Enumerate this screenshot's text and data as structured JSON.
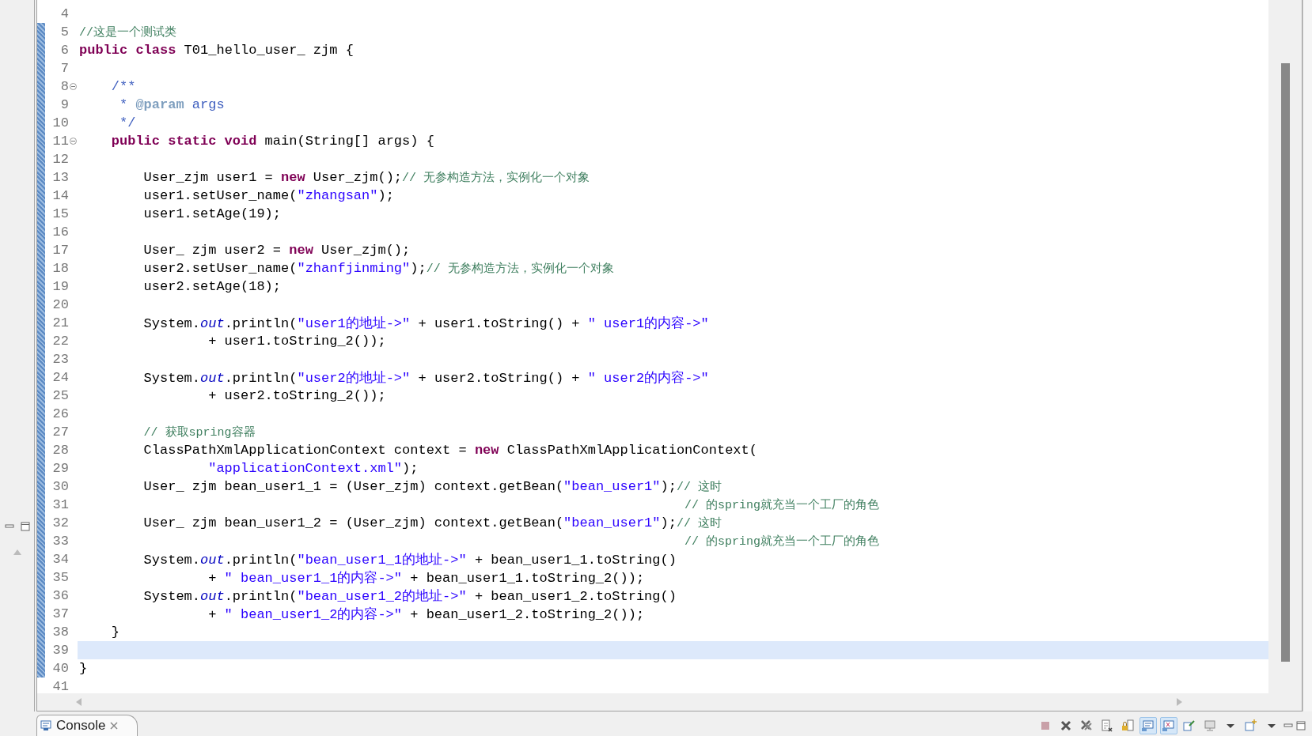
{
  "editor": {
    "lines": [
      {
        "number": "4",
        "kind": "blank",
        "folding": false,
        "current": false,
        "changed": false
      },
      {
        "number": "5",
        "kind": "top",
        "folding": false,
        "current": false,
        "changed": true,
        "segments": [
          {
            "kind": "comment",
            "text": "//这是一个测试类"
          }
        ]
      },
      {
        "number": "6",
        "kind": "top",
        "folding": false,
        "current": false,
        "changed": true,
        "segments": [
          {
            "kind": "keyword",
            "text": "public"
          },
          {
            "kind": "keyword",
            "text": "class"
          },
          {
            "kind": "plain",
            "text": " T01_hello_user_ zjm {"
          }
        ]
      },
      {
        "number": "7",
        "kind": "blank",
        "folding": false,
        "current": false,
        "changed": true
      },
      {
        "number": "8",
        "kind": "member",
        "folding": true,
        "current": false,
        "changed": true,
        "segments": [
          {
            "kind": "javadoc",
            "text": "/**"
          }
        ]
      },
      {
        "number": "9",
        "kind": "doc",
        "folding": false,
        "current": false,
        "changed": true,
        "segments": [
          {
            "kind": "javadoc",
            "text": "*"
          },
          {
            "kind": "tag",
            "text": "@param"
          },
          {
            "kind": "javadoc",
            "text": " args"
          }
        ]
      },
      {
        "number": "10",
        "kind": "doc",
        "folding": false,
        "current": false,
        "changed": true,
        "segments": [
          {
            "kind": "javadoc",
            "text": "*/"
          }
        ]
      },
      {
        "number": "11",
        "kind": "member",
        "folding": true,
        "current": false,
        "changed": true,
        "segments": [
          {
            "kind": "keyword",
            "text": "public"
          },
          {
            "kind": "keyword",
            "text": "static"
          },
          {
            "kind": "keyword",
            "text": "void"
          },
          {
            "kind": "plain",
            "text": " main(String[] args) {"
          }
        ]
      },
      {
        "number": "12",
        "kind": "blank",
        "folding": false,
        "current": false,
        "changed": true
      },
      {
        "number": "13",
        "kind": "statement",
        "folding": false,
        "current": false,
        "changed": true,
        "segments": [
          {
            "kind": "plain",
            "text": "User_zjm user1 = "
          },
          {
            "kind": "keyword",
            "text": "new"
          },
          {
            "kind": "plain",
            "text": " User_zjm();"
          },
          {
            "kind": "comment",
            "text": "// 无参构造方法，实例化一个对象"
          }
        ]
      },
      {
        "number": "14",
        "kind": "statement",
        "folding": false,
        "current": false,
        "changed": true,
        "segments": [
          {
            "kind": "plain",
            "text": "user1.setUser_name("
          },
          {
            "kind": "string",
            "text": "\"zhangsan\""
          },
          {
            "kind": "plain",
            "text": ");"
          }
        ]
      },
      {
        "number": "15",
        "kind": "statement",
        "folding": false,
        "current": false,
        "changed": true,
        "segments": [
          {
            "kind": "plain",
            "text": "user1.setAge(19);"
          }
        ]
      },
      {
        "number": "16",
        "kind": "blank",
        "folding": false,
        "current": false,
        "changed": true
      },
      {
        "number": "17",
        "kind": "statement",
        "folding": false,
        "current": false,
        "changed": true,
        "segments": [
          {
            "kind": "plain",
            "text": "User_ zjm user2 = "
          },
          {
            "kind": "keyword",
            "text": "new"
          },
          {
            "kind": "plain",
            "text": " User_zjm();"
          }
        ]
      },
      {
        "number": "18",
        "kind": "statement",
        "folding": false,
        "current": false,
        "changed": true,
        "segments": [
          {
            "kind": "plain",
            "text": "user2.setUser_name("
          },
          {
            "kind": "string",
            "text": "\"zhanfjinming\""
          },
          {
            "kind": "plain",
            "text": ");"
          },
          {
            "kind": "comment",
            "text": "// 无参构造方法，实例化一个对象"
          }
        ]
      },
      {
        "number": "19",
        "kind": "statement",
        "folding": false,
        "current": false,
        "changed": true,
        "segments": [
          {
            "kind": "plain",
            "text": "user2.setAge(18);"
          }
        ]
      },
      {
        "number": "20",
        "kind": "blank",
        "folding": false,
        "current": false,
        "changed": true
      },
      {
        "number": "21",
        "kind": "statement",
        "folding": false,
        "current": false,
        "changed": true,
        "segments": [
          {
            "kind": "plain",
            "text": "System."
          },
          {
            "kind": "field",
            "text": "out"
          },
          {
            "kind": "plain",
            "text": ".println("
          },
          {
            "kind": "string",
            "text": "\"user1的地址->\""
          },
          {
            "kind": "plain",
            "text": " + user1.toString() + "
          },
          {
            "kind": "string",
            "text": "\" user1的内容->\""
          }
        ]
      },
      {
        "number": "22",
        "kind": "continuation",
        "folding": false,
        "current": false,
        "changed": true,
        "segments": [
          {
            "kind": "plain",
            "text": "+ user1.toString_2());"
          }
        ]
      },
      {
        "number": "23",
        "kind": "blank",
        "folding": false,
        "current": false,
        "changed": true
      },
      {
        "number": "24",
        "kind": "statement",
        "folding": false,
        "current": false,
        "changed": true,
        "segments": [
          {
            "kind": "plain",
            "text": "System."
          },
          {
            "kind": "field",
            "text": "out"
          },
          {
            "kind": "plain",
            "text": ".println("
          },
          {
            "kind": "string",
            "text": "\"user2的地址->\""
          },
          {
            "kind": "plain",
            "text": " + user2.toString() + "
          },
          {
            "kind": "string",
            "text": "\" user2的内容->\""
          }
        ]
      },
      {
        "number": "25",
        "kind": "continuation",
        "folding": false,
        "current": false,
        "changed": true,
        "segments": [
          {
            "kind": "plain",
            "text": "+ user2.toString_2());"
          }
        ]
      },
      {
        "number": "26",
        "kind": "blank",
        "folding": false,
        "current": false,
        "changed": true
      },
      {
        "number": "27",
        "kind": "statement",
        "folding": false,
        "current": false,
        "changed": true,
        "segments": [
          {
            "kind": "comment",
            "text": "// 获取spring容器"
          }
        ]
      },
      {
        "number": "28",
        "kind": "statement",
        "folding": false,
        "current": false,
        "changed": true,
        "segments": [
          {
            "kind": "plain",
            "text": "ClassPathXmlApplicationContext context = "
          },
          {
            "kind": "keyword",
            "text": "new"
          },
          {
            "kind": "plain",
            "text": " ClassPathXmlApplicationContext("
          }
        ]
      },
      {
        "number": "29",
        "kind": "continuation",
        "folding": false,
        "current": false,
        "changed": true,
        "segments": [
          {
            "kind": "string",
            "text": "\"applicationContext.xml\""
          },
          {
            "kind": "plain",
            "text": ");"
          }
        ]
      },
      {
        "number": "30",
        "kind": "statement",
        "folding": false,
        "current": false,
        "changed": true,
        "segments": [
          {
            "kind": "plain",
            "text": "User_ zjm bean_user1_1 = (User_zjm) context.getBean("
          },
          {
            "kind": "string",
            "text": "\"bean_user1\""
          },
          {
            "kind": "plain",
            "text": ");"
          },
          {
            "kind": "comment",
            "text": "// 这时"
          }
        ]
      },
      {
        "number": "31",
        "kind": "wrapped",
        "folding": false,
        "current": false,
        "changed": true,
        "segments": [
          {
            "kind": "comment",
            "text": "// 的spring就充当一个工厂的角色"
          }
        ]
      },
      {
        "number": "32",
        "kind": "statement",
        "folding": false,
        "current": false,
        "changed": true,
        "segments": [
          {
            "kind": "plain",
            "text": "User_ zjm bean_user1_2 = (User_zjm) context.getBean("
          },
          {
            "kind": "string",
            "text": "\"bean_user1\""
          },
          {
            "kind": "plain",
            "text": ");"
          },
          {
            "kind": "comment",
            "text": "// 这时"
          }
        ]
      },
      {
        "number": "33",
        "kind": "wrapped",
        "folding": false,
        "current": false,
        "changed": true,
        "segments": [
          {
            "kind": "comment",
            "text": "// 的spring就充当一个工厂的角色"
          }
        ]
      },
      {
        "number": "34",
        "kind": "statement",
        "folding": false,
        "current": false,
        "changed": true,
        "segments": [
          {
            "kind": "plain",
            "text": "System."
          },
          {
            "kind": "field",
            "text": "out"
          },
          {
            "kind": "plain",
            "text": ".println("
          },
          {
            "kind": "string",
            "text": "\"bean_user1_1的地址->\""
          },
          {
            "kind": "plain",
            "text": " + bean_user1_1.toString()"
          }
        ]
      },
      {
        "number": "35",
        "kind": "continuation",
        "folding": false,
        "current": false,
        "changed": true,
        "segments": [
          {
            "kind": "plain",
            "text": "+ "
          },
          {
            "kind": "string",
            "text": "\" bean_user1_1的内容->\""
          },
          {
            "kind": "plain",
            "text": " + bean_user1_1.toString_2());"
          }
        ]
      },
      {
        "number": "36",
        "kind": "statement",
        "folding": false,
        "current": false,
        "changed": true,
        "segments": [
          {
            "kind": "plain",
            "text": "System."
          },
          {
            "kind": "field",
            "text": "out"
          },
          {
            "kind": "plain",
            "text": ".println("
          },
          {
            "kind": "string",
            "text": "\"bean_user1_2的地址->\""
          },
          {
            "kind": "plain",
            "text": " + bean_user1_2.toString()"
          }
        ]
      },
      {
        "number": "37",
        "kind": "continuation",
        "folding": false,
        "current": false,
        "changed": true,
        "segments": [
          {
            "kind": "plain",
            "text": "+ "
          },
          {
            "kind": "string",
            "text": "\" bean_user1_2的内容->\""
          },
          {
            "kind": "plain",
            "text": " + bean_user1_2.toString_2());"
          }
        ]
      },
      {
        "number": "38",
        "kind": "member",
        "folding": false,
        "current": false,
        "changed": true,
        "segments": [
          {
            "kind": "plain",
            "text": "}"
          }
        ]
      },
      {
        "number": "39",
        "kind": "blank",
        "folding": false,
        "current": true,
        "changed": true
      },
      {
        "number": "40",
        "kind": "top",
        "folding": false,
        "current": false,
        "changed": true,
        "segments": [
          {
            "kind": "plain",
            "text": "}"
          }
        ]
      },
      {
        "number": "41",
        "kind": "blank",
        "folding": false,
        "current": false,
        "changed": false
      }
    ]
  },
  "console": {
    "tab": {
      "label": "Console",
      "selected": true
    },
    "toolbar": [
      {
        "kind": "terminate",
        "on": false
      },
      {
        "kind": "remove",
        "on": false
      },
      {
        "kind": "remove-all",
        "on": false
      },
      {
        "kind": "document",
        "on": false
      },
      {
        "kind": "lock",
        "on": false
      },
      {
        "kind": "show-out",
        "on": true
      },
      {
        "kind": "show-err",
        "on": true
      },
      {
        "kind": "pin",
        "on": false
      },
      {
        "kind": "display",
        "on": false
      },
      {
        "kind": "dropdown",
        "on": false
      },
      {
        "kind": "open",
        "on": false
      },
      {
        "kind": "dropdown",
        "on": false
      }
    ]
  }
}
